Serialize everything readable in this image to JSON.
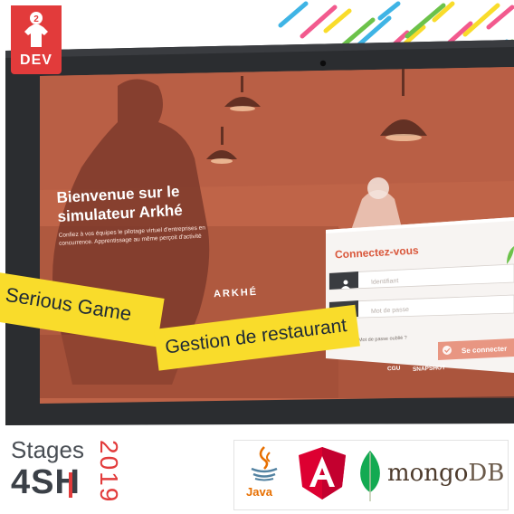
{
  "badge": {
    "label": "DEV",
    "color": "#e23b3b"
  },
  "screen": {
    "title_line1": "Bienvenue sur le",
    "title_line2": "simulateur Arkhé",
    "subtitle_line1": "Confiez à vos équipes le pilotage virtuel d'entreprises en",
    "subtitle_line2": "concurrence. Apprentissage au même perçoit d'activité",
    "brand": "ARKHÉ"
  },
  "login": {
    "title": "Connectez-vous",
    "username_placeholder": "Identifiant",
    "password_placeholder": "Mot de passe",
    "forgot": "Mot de passe oublié ?",
    "submit": "Se connecter",
    "footer_logo1": "CGU",
    "footer_logo2": "SNAPSHOT"
  },
  "banners": {
    "serious": "Serious Game",
    "gestion": "Gestion de restaurant"
  },
  "footer": {
    "stages": "Stages",
    "company": "4SH",
    "year": "2019",
    "java": "Java",
    "mongo_a": "mongo",
    "mongo_b": "DB"
  },
  "colors": {
    "accent": "#e23b3b",
    "banner": "#f9dc2b",
    "screen_tint": "#c9664b",
    "login_title": "#d9573b",
    "button": "#e89682"
  }
}
